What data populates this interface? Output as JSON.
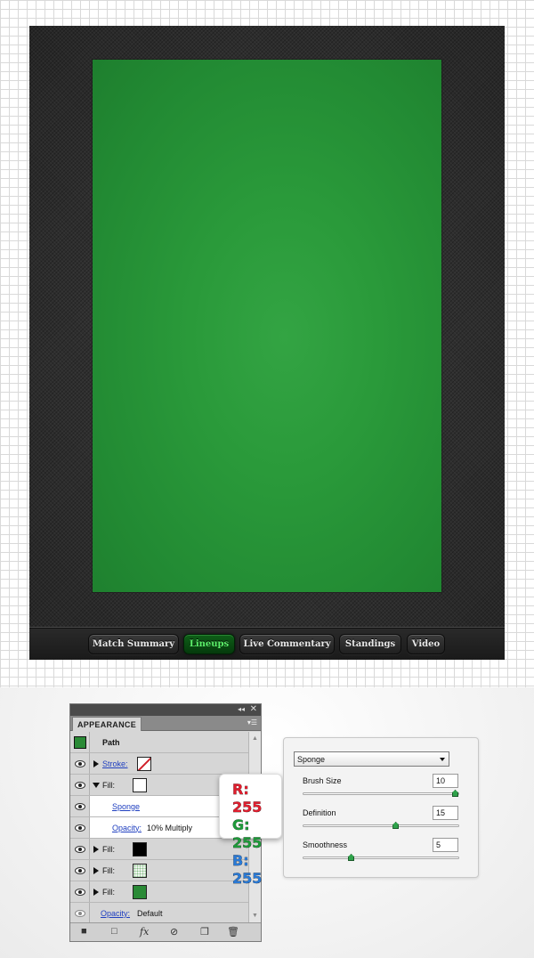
{
  "colors": {
    "field_green": "#2a9a3a",
    "frame_dark": "#2d2d2d",
    "active_tab_text": "#5cf06a",
    "red": "#e01e2e",
    "green": "#1e9a3a",
    "blue": "#2a7ad6"
  },
  "tabs": [
    {
      "label": "Match Summary",
      "active": false
    },
    {
      "label": "Lineups",
      "active": true
    },
    {
      "label": "Live Commentary",
      "active": false
    },
    {
      "label": "Standings",
      "active": false
    },
    {
      "label": "Video",
      "active": false
    }
  ],
  "appearance": {
    "title": "APPEARANCE",
    "object_label": "Path",
    "rows": {
      "stroke_label": "Stroke:",
      "fill1_label": "Fill:",
      "sponge_effect": "Sponge",
      "opacity_link": "Opacity:",
      "opacity_value": "10% Multiply",
      "fill2_label": "Fill:",
      "fill3_label": "Fill:",
      "fill4_label": "Fill:",
      "final_opacity_link": "Opacity:",
      "final_opacity_value": "Default"
    },
    "icons": [
      "eye-icon",
      "disclosure-triangle-icon",
      "fx-icon",
      "clear-icon",
      "new-item-icon",
      "trash-icon"
    ]
  },
  "rgb": {
    "r": "R: 255",
    "g": "G: 255",
    "b": "B: 255"
  },
  "sponge": {
    "selected": "Sponge",
    "params": [
      {
        "label": "Brush Size",
        "value": "10",
        "fraction": 1.0
      },
      {
        "label": "Definition",
        "value": "15",
        "fraction": 0.6
      },
      {
        "label": "Smoothness",
        "value": "5",
        "fraction": 0.3
      }
    ]
  }
}
